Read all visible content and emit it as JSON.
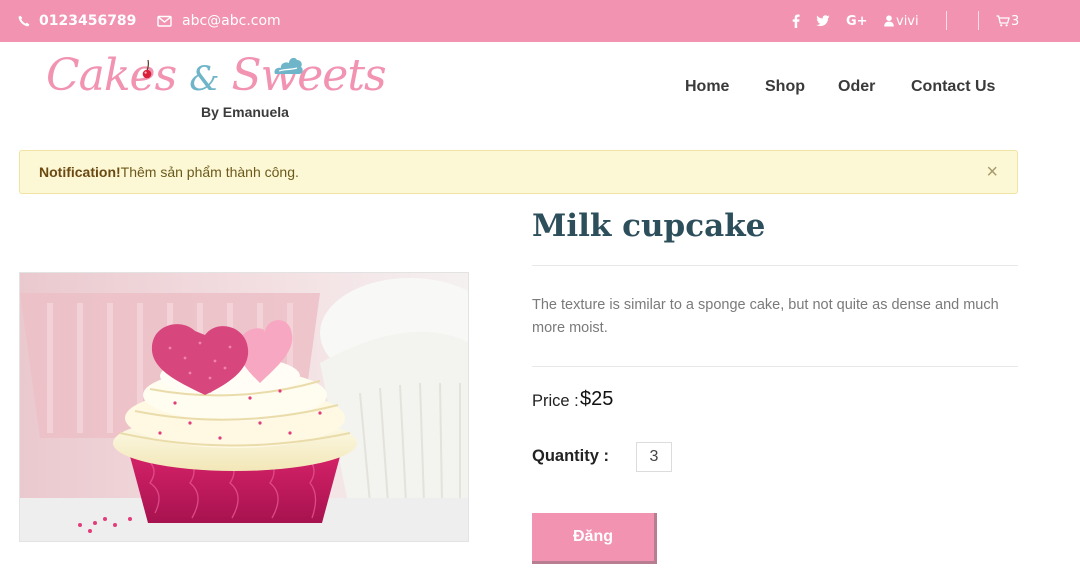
{
  "topbar": {
    "phone": "0123456789",
    "email": "abc@abc.com",
    "social": {
      "facebook": "f",
      "twitter": "twitter-icon",
      "google_plus": "G+"
    },
    "user": "vivi",
    "cart_count": "3",
    "color": "#f193b1"
  },
  "header": {
    "logo_title_1": "Cakes",
    "logo_amp": "&",
    "logo_title_2": "Sweets",
    "logo_sub": "By Emanuela",
    "nav": [
      "Home",
      "Shop",
      "Oder",
      "Contact Us"
    ]
  },
  "alert": {
    "title": "Notification!",
    "message": "Thêm sản phẩm thành công.",
    "close": "×"
  },
  "product": {
    "title": "Milk cupcake",
    "description": "The texture is similar to a sponge cake, but not quite as dense and much more moist.",
    "price_label": "Price :",
    "price_value": "$25",
    "quantity_label": "Quantity :",
    "quantity_value": "3",
    "submit_label": "Đăng"
  },
  "icons": [
    "phone-icon",
    "envelope-icon",
    "facebook-icon",
    "twitter-icon",
    "google-plus-icon",
    "user-icon",
    "cart-icon",
    "close-icon"
  ]
}
